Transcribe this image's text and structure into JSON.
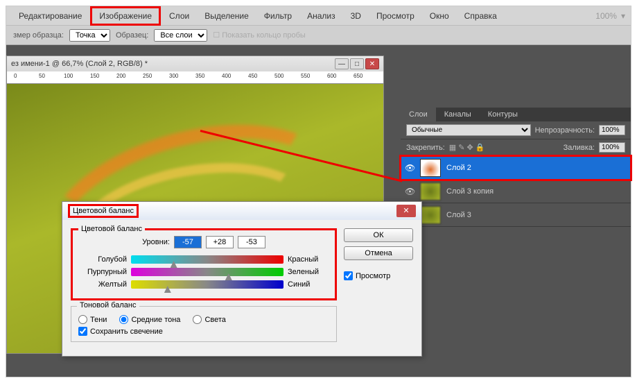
{
  "menu": {
    "edit": "Редактирование",
    "image": "Изображение",
    "layers": "Слои",
    "select": "Выделение",
    "filter": "Фильтр",
    "analysis": "Анализ",
    "threeD": "3D",
    "view": "Просмотр",
    "window": "Окно",
    "help": "Справка"
  },
  "zoom": "100%",
  "optbar": {
    "size_label": "змер образца:",
    "size_val": "Точка",
    "sample_label": "Образец:",
    "sample_val": "Все слои",
    "ring": "Показать кольцо пробы"
  },
  "doc": {
    "title": "ез имени-1 @ 66,7% (Слой 2, RGB/8) *"
  },
  "ruler": [
    "0",
    "50",
    "100",
    "150",
    "200",
    "250",
    "300",
    "350",
    "400",
    "450",
    "500",
    "550",
    "600",
    "650"
  ],
  "panel": {
    "tabs": {
      "layers": "Слои",
      "channels": "Каналы",
      "paths": "Контуры"
    },
    "blend": "Обычные",
    "opacity_lbl": "Непрозрачность:",
    "opacity": "100%",
    "lock_lbl": "Закрепить:",
    "fill_lbl": "Заливка:",
    "fill": "100%",
    "layers_list": [
      {
        "name": "Слой 2"
      },
      {
        "name": "Слой 3 копия"
      },
      {
        "name": "Слой 3"
      }
    ]
  },
  "dialog": {
    "title": "Цветовой баланс",
    "ok": "ОК",
    "cancel": "Отмена",
    "preview": "Просмотр",
    "cb_legend": "Цветовой баланс",
    "levels_lbl": "Уровни:",
    "levels": [
      "-57",
      "+28",
      "-53"
    ],
    "sliders": [
      {
        "l": "Голубой",
        "r": "Красный",
        "pos": 28
      },
      {
        "l": "Пурпурный",
        "r": "Зеленый",
        "pos": 64
      },
      {
        "l": "Желтый",
        "r": "Синий",
        "pos": 24
      }
    ],
    "tb_legend": "Тоновой баланс",
    "tones": {
      "shadows": "Тени",
      "mid": "Средние тона",
      "high": "Света"
    },
    "preserve": "Сохранить свечение"
  }
}
